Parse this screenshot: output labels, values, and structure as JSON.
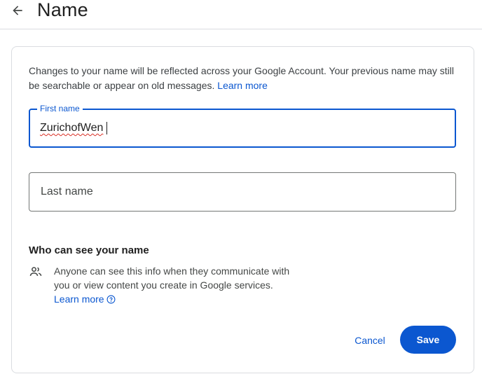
{
  "header": {
    "title": "Name",
    "back_icon": "arrow-left-icon"
  },
  "intro": {
    "text": "Changes to your name will be reflected across your Google Account. Your previous name may still be searchable or appear on old messages. ",
    "link": "Learn more"
  },
  "fields": {
    "first_name": {
      "label": "First name",
      "value": "ZurichofWen"
    },
    "last_name": {
      "placeholder": "Last name",
      "value": ""
    }
  },
  "visibility": {
    "title": "Who can see your name",
    "icon": "people-icon",
    "text": "Anyone can see this info when they communicate with you or view content you create in Google services.",
    "link": "Learn more",
    "link_icon": "help-circle-icon"
  },
  "actions": {
    "cancel_label": "Cancel",
    "save_label": "Save"
  },
  "colors": {
    "accent": "#0b57d0",
    "border": "#dadce0",
    "spellcheck_underline": "#d93025"
  }
}
